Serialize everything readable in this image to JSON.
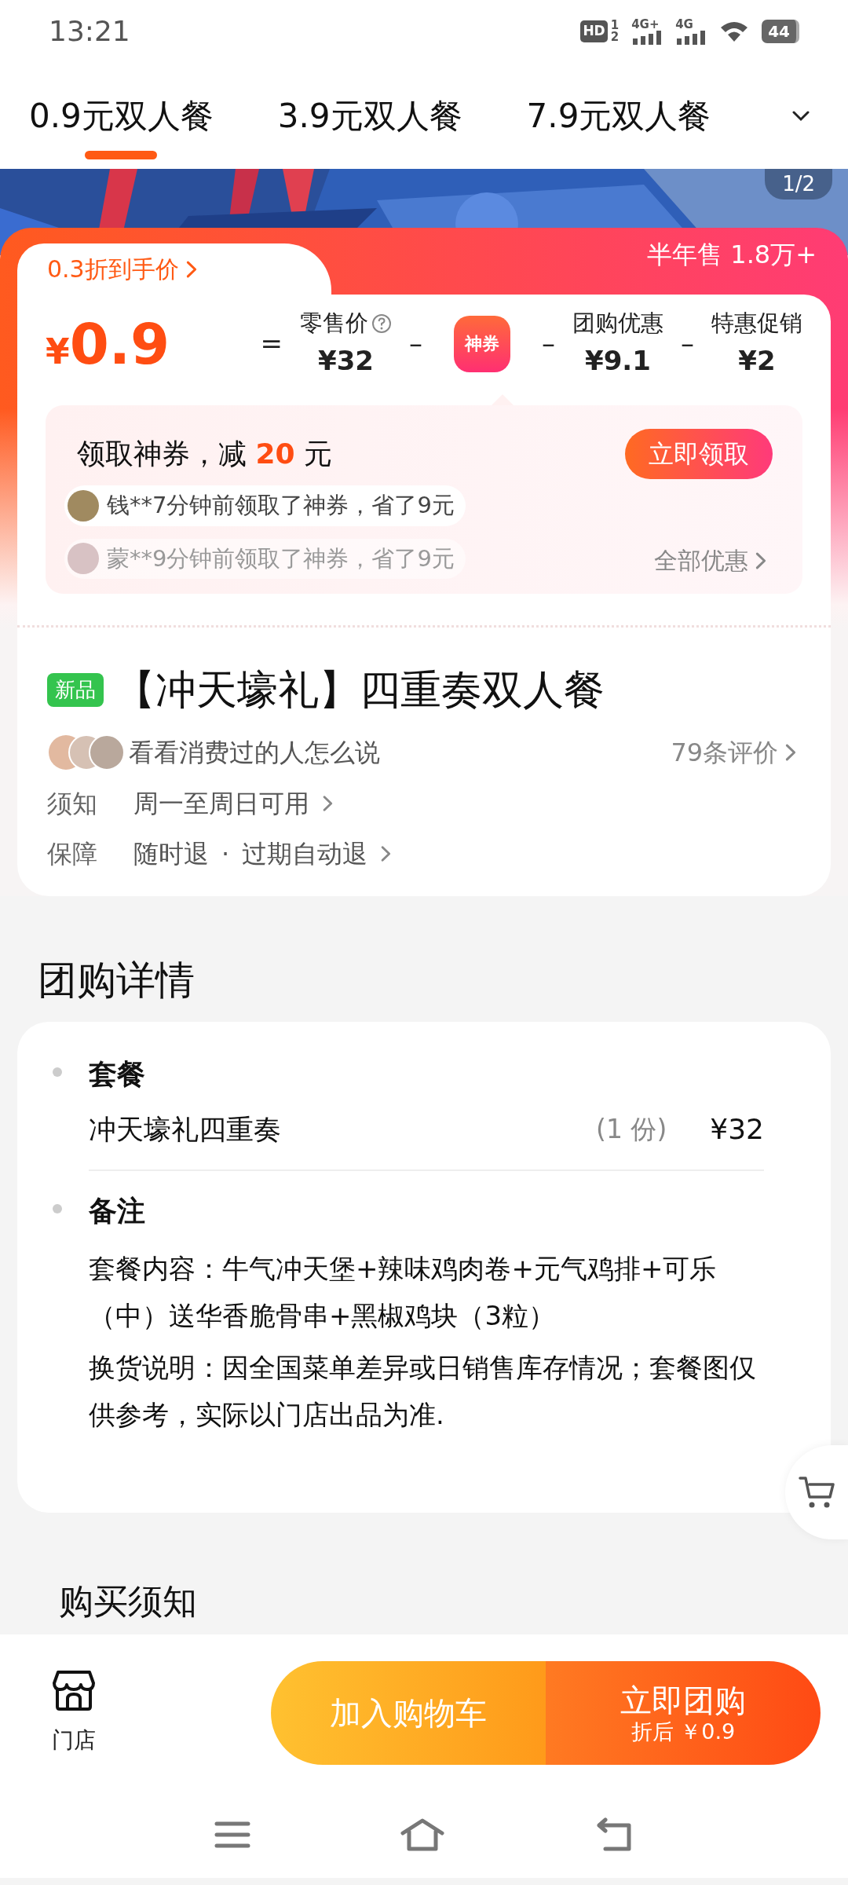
{
  "status_bar": {
    "time": "13:21",
    "indicators": [
      {
        "kind": "hd",
        "label": "HD",
        "sub": [
          "1",
          "2"
        ]
      },
      {
        "kind": "signal",
        "label": "4G+"
      },
      {
        "kind": "signal",
        "label": "4G"
      },
      {
        "kind": "wifi"
      }
    ],
    "battery": "44"
  },
  "tabs": [
    {
      "label": "0.9元双人餐",
      "selected": true
    },
    {
      "label": "3.9元双人餐",
      "selected": false
    },
    {
      "label": "7.9元双人餐",
      "selected": false
    }
  ],
  "banner": {
    "kind": "picture",
    "page_indicator": "1/2"
  },
  "deal": {
    "final_label": "0.3折到手价",
    "sales": "半年售 1.8万+",
    "currency": "¥",
    "price": "0.9",
    "breakdown": [
      {
        "kind": "amount",
        "operator": "=",
        "label": "零售价",
        "help": true,
        "value": "¥32"
      },
      {
        "kind": "coupon",
        "operator": "–",
        "icon_text": "神券"
      },
      {
        "kind": "amount",
        "operator": "–",
        "label": "团购优惠",
        "help": false,
        "value": "¥9.1"
      },
      {
        "kind": "amount",
        "operator": "–",
        "label": "特惠促销",
        "help": false,
        "value": "¥2"
      }
    ],
    "coupon": {
      "title_prefix": "领取神券，减 ",
      "amount": "20",
      "title_suffix": " 元",
      "button": "立即领取",
      "all_offers": "全部优惠",
      "activity": [
        {
          "text": "钱**7分钟前领取了神券，省了9元",
          "faded": false
        },
        {
          "text": "蒙**9分钟前领取了神券，省了9元",
          "faded": true
        }
      ]
    }
  },
  "product": {
    "badge": "新品",
    "title": "【冲天壕礼】四重奏双人餐",
    "reviews_prompt": "看看消费过的人怎么说",
    "review_count": "79条评价",
    "notes": [
      {
        "label": "须知",
        "items": [
          "周一至周日可用"
        ]
      },
      {
        "label": "保障",
        "items": [
          "随时退",
          "过期自动退"
        ]
      }
    ],
    "separator": "·"
  },
  "details": {
    "heading": "团购详情",
    "sections": [
      {
        "kind": "items",
        "heading": "套餐",
        "items": [
          {
            "name": "冲天壕礼四重奏",
            "qty": "(1 份)",
            "price": "¥32"
          }
        ]
      },
      {
        "kind": "notes",
        "heading": "备注",
        "paragraphs": [
          "套餐内容：牛气冲天堡+辣味鸡肉卷+元气鸡排+可乐（中）送华香脆骨串+黑椒鸡块（3粒）",
          "换货说明：因全国菜单差异或日销售库存情况；套餐图仅供参考，实际以门店出品为准."
        ]
      }
    ]
  },
  "purchase_notes": {
    "heading": "购买须知"
  },
  "bottom_bar": {
    "store": "门店",
    "cart_button": "加入购物车",
    "buy_button": {
      "label": "立即团购",
      "sub": "折后 ￥0.9"
    }
  }
}
